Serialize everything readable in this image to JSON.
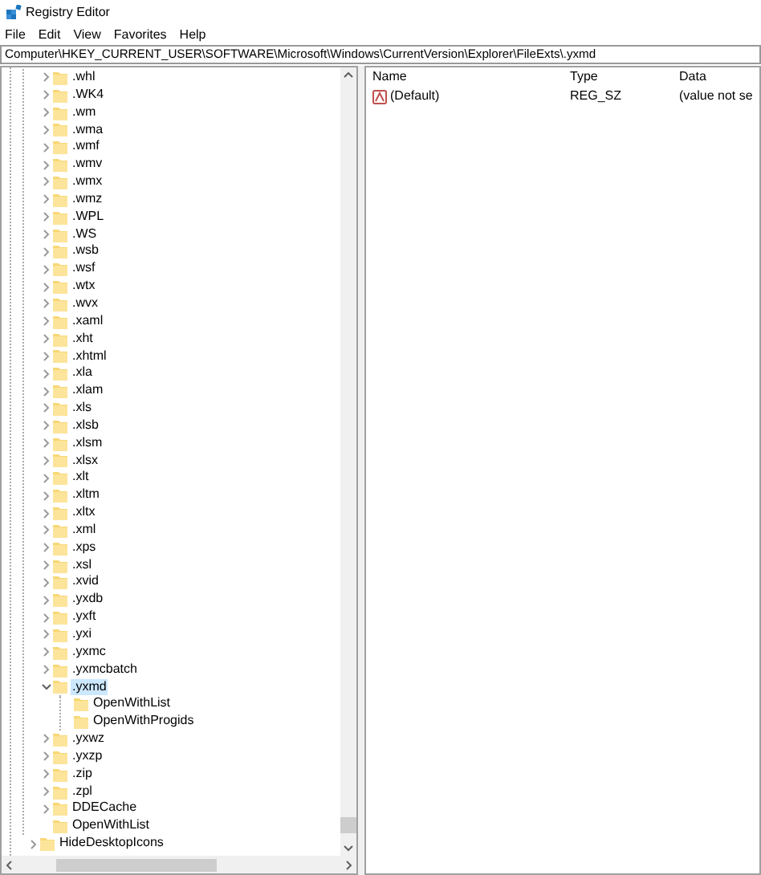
{
  "window": {
    "title": "Registry Editor"
  },
  "menu": [
    "File",
    "Edit",
    "View",
    "Favorites",
    "Help"
  ],
  "address": "Computer\\HKEY_CURRENT_USER\\SOFTWARE\\Microsoft\\Windows\\CurrentVersion\\Explorer\\FileExts\\.yxmd",
  "tree": {
    "rows": [
      {
        "label": ".whl",
        "kind": "branch",
        "selected": false
      },
      {
        "label": ".WK4",
        "kind": "branch",
        "selected": false
      },
      {
        "label": ".wm",
        "kind": "branch",
        "selected": false
      },
      {
        "label": ".wma",
        "kind": "branch",
        "selected": false
      },
      {
        "label": ".wmf",
        "kind": "branch",
        "selected": false
      },
      {
        "label": ".wmv",
        "kind": "branch",
        "selected": false
      },
      {
        "label": ".wmx",
        "kind": "branch",
        "selected": false
      },
      {
        "label": ".wmz",
        "kind": "branch",
        "selected": false
      },
      {
        "label": ".WPL",
        "kind": "branch",
        "selected": false
      },
      {
        "label": ".WS",
        "kind": "branch",
        "selected": false
      },
      {
        "label": ".wsb",
        "kind": "branch",
        "selected": false
      },
      {
        "label": ".wsf",
        "kind": "branch",
        "selected": false
      },
      {
        "label": ".wtx",
        "kind": "branch",
        "selected": false
      },
      {
        "label": ".wvx",
        "kind": "branch",
        "selected": false
      },
      {
        "label": ".xaml",
        "kind": "branch",
        "selected": false
      },
      {
        "label": ".xht",
        "kind": "branch",
        "selected": false
      },
      {
        "label": ".xhtml",
        "kind": "branch",
        "selected": false
      },
      {
        "label": ".xla",
        "kind": "branch",
        "selected": false
      },
      {
        "label": ".xlam",
        "kind": "branch",
        "selected": false
      },
      {
        "label": ".xls",
        "kind": "branch",
        "selected": false
      },
      {
        "label": ".xlsb",
        "kind": "branch",
        "selected": false
      },
      {
        "label": ".xlsm",
        "kind": "branch",
        "selected": false
      },
      {
        "label": ".xlsx",
        "kind": "branch",
        "selected": false
      },
      {
        "label": ".xlt",
        "kind": "branch",
        "selected": false
      },
      {
        "label": ".xltm",
        "kind": "branch",
        "selected": false
      },
      {
        "label": ".xltx",
        "kind": "branch",
        "selected": false
      },
      {
        "label": ".xml",
        "kind": "branch",
        "selected": false
      },
      {
        "label": ".xps",
        "kind": "branch",
        "selected": false
      },
      {
        "label": ".xsl",
        "kind": "branch",
        "selected": false
      },
      {
        "label": ".xvid",
        "kind": "branch",
        "selected": false
      },
      {
        "label": ".yxdb",
        "kind": "branch",
        "selected": false
      },
      {
        "label": ".yxft",
        "kind": "branch",
        "selected": false
      },
      {
        "label": ".yxi",
        "kind": "branch",
        "selected": false
      },
      {
        "label": ".yxmc",
        "kind": "branch",
        "selected": false
      },
      {
        "label": ".yxmcbatch",
        "kind": "branch",
        "selected": false
      },
      {
        "label": ".yxmd",
        "kind": "expanded",
        "selected": true,
        "children": [
          {
            "label": "OpenWithList",
            "kind": "leaf",
            "selected": false
          },
          {
            "label": "OpenWithProgids",
            "kind": "leaf",
            "selected": false
          }
        ]
      },
      {
        "label": ".yxwz",
        "kind": "branch",
        "selected": false
      },
      {
        "label": ".yxzp",
        "kind": "branch",
        "selected": false
      },
      {
        "label": ".zip",
        "kind": "branch",
        "selected": false
      },
      {
        "label": ".zpl",
        "kind": "branch",
        "selected": false
      },
      {
        "label": "DDECache",
        "kind": "branch",
        "selected": false
      },
      {
        "label": "OpenWithList",
        "kind": "leaf",
        "selected": false
      }
    ],
    "after": [
      {
        "label": "HideDesktopIcons",
        "kind": "branch",
        "selected": false
      }
    ]
  },
  "values": {
    "columns": [
      "Name",
      "Type",
      "Data"
    ],
    "rows": [
      {
        "name": "(Default)",
        "type": "REG_SZ",
        "data": "(value not se"
      }
    ]
  }
}
